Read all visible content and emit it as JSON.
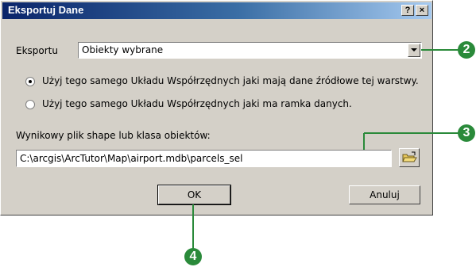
{
  "dialog": {
    "title": "Eksportuj Dane",
    "help_label": "?",
    "close_label": "×"
  },
  "export_row": {
    "label": "Eksportu",
    "selected": "Obiekty wybrane"
  },
  "coordinate_options": [
    {
      "label": "Użyj tego samego Układu Współrzędnych jaki mają dane źródłowe tej warstwy.",
      "checked": true
    },
    {
      "label": "Użyj tego samego Układu Współrzędnych jaki ma ramka danych.",
      "checked": false
    }
  ],
  "output": {
    "label": "Wynikowy plik shape lub klasa obiektów:",
    "path": "C:\\arcgis\\ArcTutor\\Map\\airport.mdb\\parcels_sel"
  },
  "buttons": {
    "ok": "OK",
    "cancel": "Anuluj"
  },
  "callouts": [
    "2",
    "3",
    "4"
  ],
  "colors": {
    "callout": "#2a8a3a",
    "titlebar_start": "#0a246a",
    "titlebar_end": "#a6caf0"
  }
}
